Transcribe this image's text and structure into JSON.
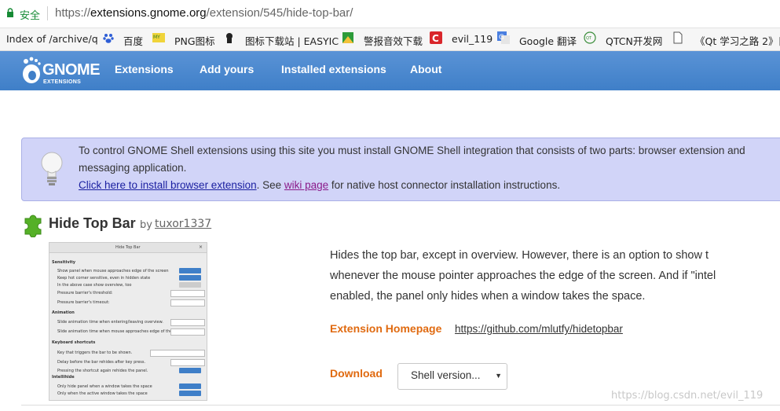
{
  "address_bar": {
    "secure_label": "安全",
    "url_scheme": "https://",
    "url_host": "extensions.gnome.org",
    "url_path": "/extension/545/hide-top-bar/"
  },
  "bookmarks": [
    {
      "label": "Index of /archive/q",
      "icon": "folder-icon"
    },
    {
      "label": "百度",
      "icon": "paw-icon"
    },
    {
      "label": "PNG图标",
      "icon": "png-icon"
    },
    {
      "label": "图标下载站 | EASYIC",
      "icon": "bear-icon"
    },
    {
      "label": "警报音效下载",
      "icon": "image-icon"
    },
    {
      "label": "evil_119",
      "icon": "csdn-icon"
    },
    {
      "label": "Google 翻译",
      "icon": "translate-icon"
    },
    {
      "label": "QTCN开发网",
      "icon": "qtcn-icon"
    },
    {
      "label": "《Qt 学习之路 2》目",
      "icon": "page-icon"
    }
  ],
  "header": {
    "logo_text": "GNOME",
    "logo_sub": "EXTENSIONS",
    "nav": [
      "Extensions",
      "Add yours",
      "Installed extensions",
      "About"
    ]
  },
  "banner": {
    "line1": "To control GNOME Shell extensions using this site you must install GNOME Shell integration that consists of two parts: browser extension and",
    "line2": "messaging application.",
    "install_link": "Click here to install browser extension",
    "see_text": ". See ",
    "wiki_link": "wiki page",
    "rest": " for native host connector installation instructions."
  },
  "extension": {
    "name": "Hide Top Bar",
    "by": "by",
    "author": "tuxor1337",
    "description_lines": [
      "Hides the top bar, except in overview. However, there is an option to show t",
      "whenever the mouse pointer approaches the edge of the screen. And if \"intel",
      "enabled, the panel only hides when a window takes the space."
    ],
    "homepage_label": "Extension Homepage",
    "homepage_url": "https://github.com/mlutfy/hidetopbar",
    "download_label": "Download",
    "shell_version_placeholder": "Shell version..."
  },
  "screenshot_preview": {
    "title": "Hide Top Bar",
    "sections": [
      {
        "heading": "Sensitivity",
        "rows": [
          "Show panel when mouse approaches edge of the screen",
          "Keep hot corner sensitive, even in hidden state",
          "In the above case show overview, too",
          "Pressure barrier's threshold:",
          "Pressure barrier's timeout:"
        ]
      },
      {
        "heading": "Animation",
        "rows": [
          "Slide animation time when entering/leaving overview.",
          "Slide animation time when mouse approaches edge of the screen."
        ]
      },
      {
        "heading": "Keyboard shortcuts",
        "rows": [
          "Key that triggers the bar to be shown.",
          "Delay before the bar rehides after key press.",
          "Pressing the shortcut again rehides the panel."
        ]
      },
      {
        "heading": "Intellihide",
        "rows": [
          "Only hide panel when a window takes the space",
          "Only when the active window takes the space"
        ]
      }
    ]
  },
  "watermark": "https://blog.csdn.net/evil_119",
  "colors": {
    "header_blue": "#3f7fc8",
    "banner_bg": "#d1d4f8",
    "accent_orange": "#e06a10",
    "secure_green": "#168a35"
  }
}
